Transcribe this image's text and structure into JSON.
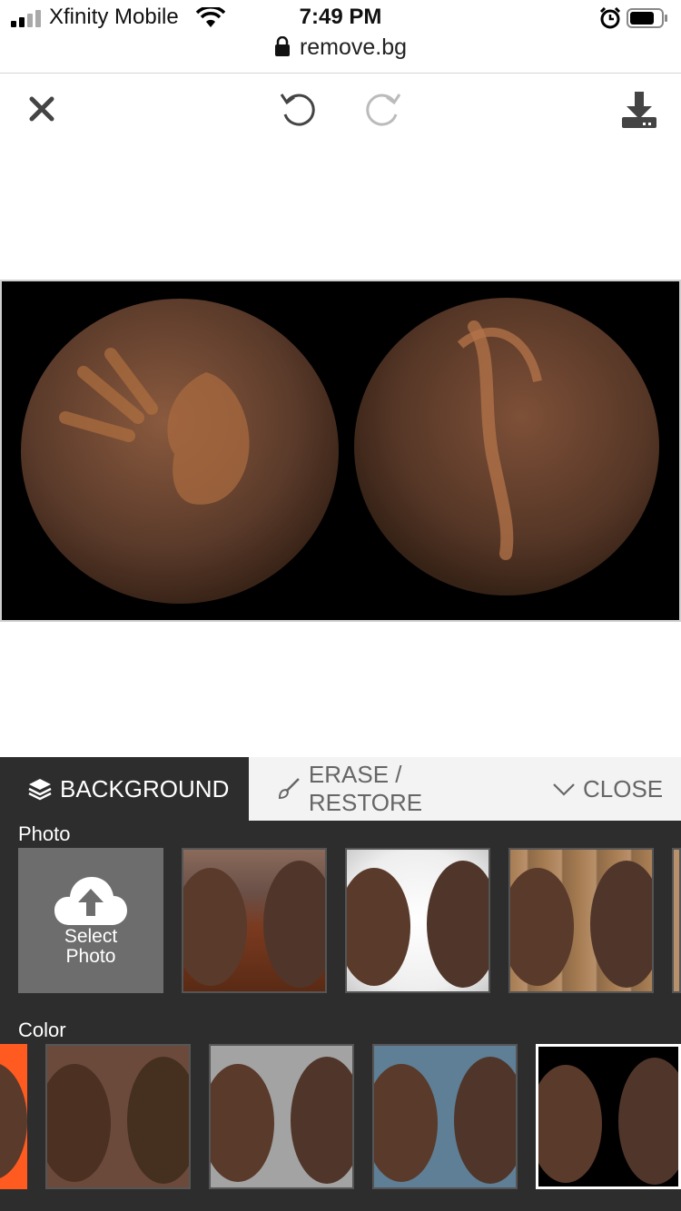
{
  "status": {
    "carrier": "Xfinity Mobile",
    "time": "7:49 PM",
    "url": "remove.bg"
  },
  "toolbar": {
    "icons": [
      "close-icon",
      "undo-icon",
      "redo-icon",
      "download-icon"
    ]
  },
  "panel": {
    "tabs": [
      {
        "label": "BACKGROUND",
        "icon": "layers-icon",
        "active": true
      },
      {
        "label": "ERASE / RESTORE",
        "icon": "brush-icon",
        "active": false
      },
      {
        "label": "CLOSE",
        "icon": "chevron-down-icon",
        "active": false
      }
    ],
    "photo_section": {
      "label": "Photo",
      "select_line1": "Select",
      "select_line2": "Photo",
      "backgrounds": [
        "brick-wall-wood-floor",
        "white-light",
        "wood-planks",
        "partial"
      ]
    },
    "color_section": {
      "label": "Color",
      "swatches": [
        "#ff5a1f",
        "#6b4a3c",
        "#a3a3a3",
        "#5e7f95",
        "#000000"
      ],
      "selected": "#000000"
    }
  }
}
